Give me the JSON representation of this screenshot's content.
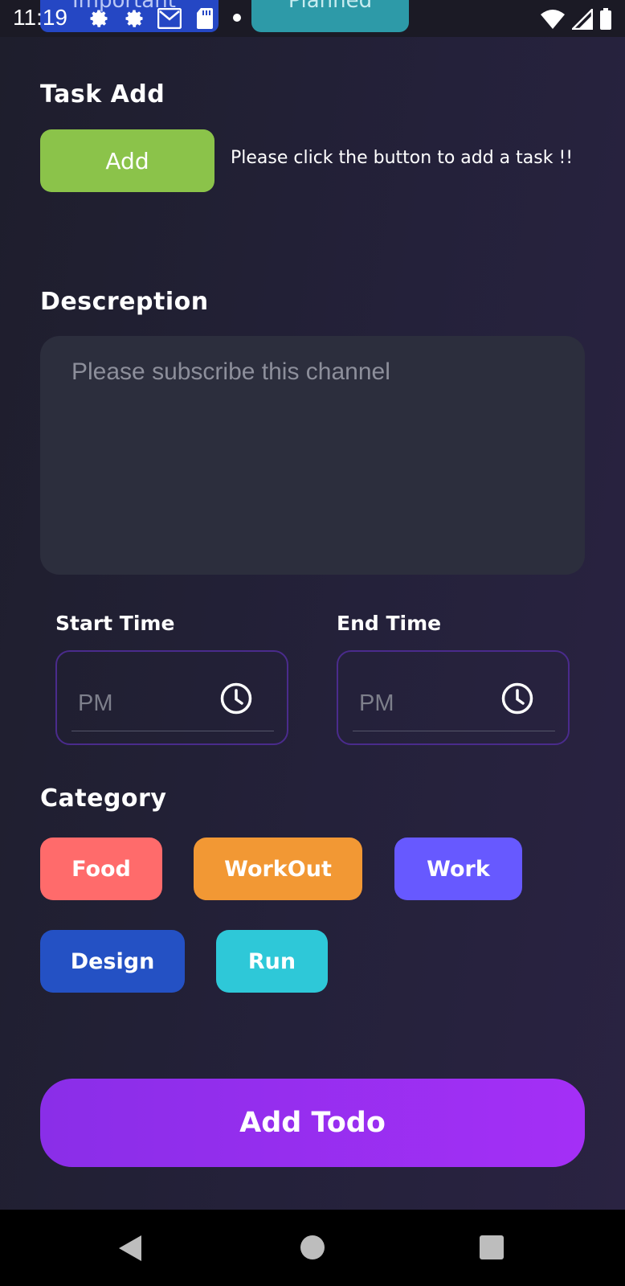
{
  "status_bar": {
    "time": "11:19",
    "tabs": [
      {
        "label": "Important",
        "color": "#2547c4"
      },
      {
        "label": "Planned",
        "color": "#2d9aa8"
      }
    ]
  },
  "task_add": {
    "title": "Task Add",
    "button_label": "Add",
    "hint": "Please click the button to add a task !!"
  },
  "description": {
    "title": "Descreption",
    "placeholder": "Please subscribe this channel"
  },
  "times": {
    "start_label": "Start Time",
    "start_placeholder": "PM",
    "end_label": "End Time",
    "end_placeholder": "PM"
  },
  "category": {
    "title": "Category",
    "items": [
      {
        "label": "Food",
        "color": "#ff6b6b"
      },
      {
        "label": "WorkOut",
        "color": "#f29834"
      },
      {
        "label": "Work",
        "color": "#6759ff"
      },
      {
        "label": "Design",
        "color": "#2451c4"
      },
      {
        "label": "Run",
        "color": "#2ec8d8"
      }
    ]
  },
  "submit": {
    "label": "Add Todo"
  },
  "colors": {
    "accent": "#a42ff6",
    "add_button": "#8bc34a"
  }
}
